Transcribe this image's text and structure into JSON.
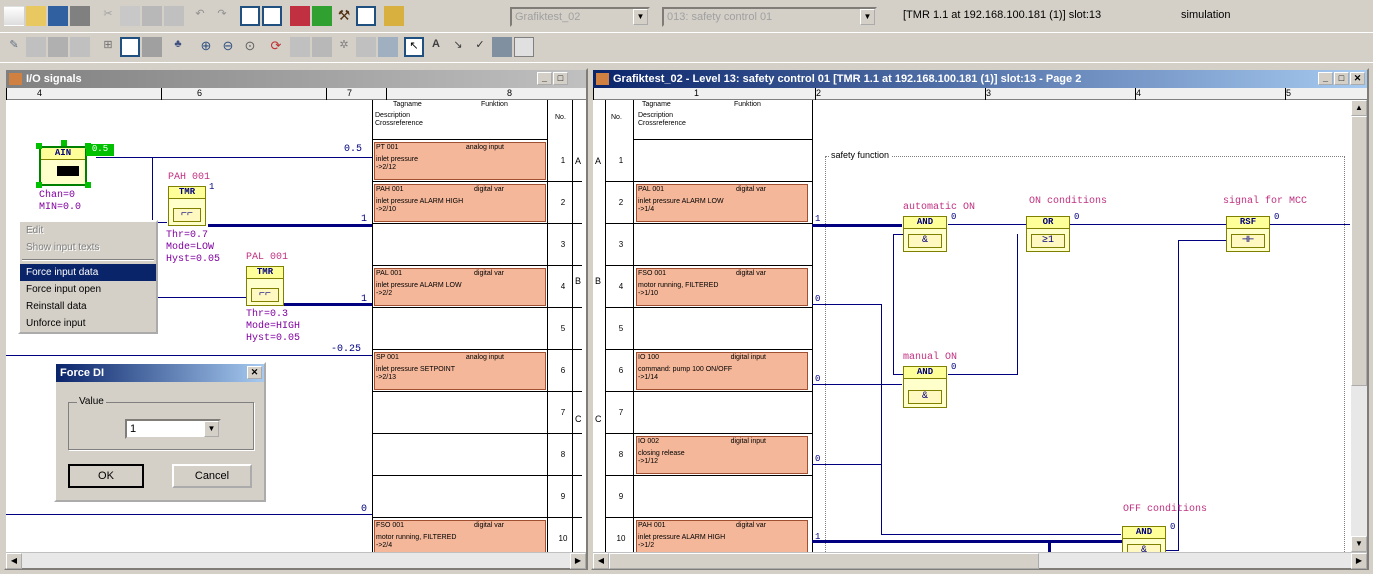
{
  "toolbar": {
    "combo1": "Grafiktest_02",
    "combo2": "013: safety control 01",
    "combo3": "[TMR 1.1 at 192.168.100.181 (1)] slot:13",
    "combo4": "simulation"
  },
  "left_window": {
    "title": "I/O signals",
    "ruler": [
      "4",
      "6",
      "7",
      "8"
    ],
    "table_header": {
      "tagname": "Tagname",
      "function": "Funktion",
      "description": "Description",
      "cross": "Crossreference",
      "no": "No."
    },
    "rows": [
      {
        "no": "1",
        "tag": "PT 001",
        "func": "analog input",
        "desc": "inlet pressure",
        "ref": "->2/12",
        "value": "0.5"
      },
      {
        "no": "2",
        "tag": "PAH 001",
        "func": "digital var",
        "desc": "inlet pressure ALARM HIGH",
        "ref": "->2/10",
        "value": "1"
      },
      {
        "no": "3"
      },
      {
        "no": "4",
        "tag": "PAL 001",
        "func": "digital var",
        "desc": "inlet pressure ALARM LOW",
        "ref": "->2/2",
        "value": "1"
      },
      {
        "no": "5"
      },
      {
        "no": "6",
        "tag": "SP 001",
        "func": "analog input",
        "desc": "inlet pressure SETPOINT",
        "ref": "->2/13",
        "value": "-0.25"
      },
      {
        "no": "7"
      },
      {
        "no": "8"
      },
      {
        "no": "9"
      },
      {
        "no": "10",
        "tag": "FSO 001",
        "func": "digital var",
        "desc": "motor running, FILTERED",
        "ref": "->2/4",
        "value": "0"
      }
    ],
    "row_letters": [
      "A",
      "B",
      "C"
    ],
    "fb": {
      "ain": {
        "name": "AIN",
        "sub": "Chan=0",
        "sub2": "MIN=0.0",
        "value_tag": "0.5"
      },
      "pah": {
        "label": "PAH 001",
        "type": "TMR",
        "p1": "Thr=0.7",
        "p2": "Mode=LOW",
        "p3": "Hyst=0.05"
      },
      "pal": {
        "label": "PAL 001",
        "type": "TMR",
        "p1": "Thr=0.3",
        "p2": "Mode=HIGH",
        "p3": "Hyst=0.05"
      }
    }
  },
  "context_menu": {
    "items": [
      {
        "label": "Edit",
        "state": "dis"
      },
      {
        "label": "Show input texts",
        "state": "dis"
      },
      {
        "label": "Force input data",
        "state": "sel"
      },
      {
        "label": "Force input open",
        "state": ""
      },
      {
        "label": "Reinstall data",
        "state": ""
      },
      {
        "label": "Unforce input",
        "state": ""
      }
    ]
  },
  "dialog": {
    "title": "Force DI",
    "group": "Value",
    "value": "1",
    "ok": "OK",
    "cancel": "Cancel"
  },
  "right_window": {
    "title": "Grafiktest_02 - Level 13: safety control 01 [TMR 1.1 at 192.168.100.181 (1)] slot:13 - Page 2",
    "ruler": [
      "1",
      "2",
      "3",
      "4",
      "5"
    ],
    "rows": [
      {
        "no": "1"
      },
      {
        "no": "2",
        "tag": "PAL 001",
        "func": "digital var",
        "desc": "inlet pressure ALARM LOW",
        "ref": "->1/4",
        "value": "1"
      },
      {
        "no": "3"
      },
      {
        "no": "4",
        "tag": "FSO 001",
        "func": "digital var",
        "desc": "motor running, FILTERED",
        "ref": "->1/10",
        "value": "0"
      },
      {
        "no": "5"
      },
      {
        "no": "6",
        "tag": "IO 100",
        "func": "digital input",
        "desc": "command: pump 100 ON/OFF",
        "ref": "->1/14",
        "value": "0"
      },
      {
        "no": "7"
      },
      {
        "no": "8",
        "tag": "IO 002",
        "func": "digital input",
        "desc": "closing release",
        "ref": "->1/12",
        "value": "0"
      },
      {
        "no": "9"
      },
      {
        "no": "10",
        "tag": "PAH 001",
        "func": "digital var",
        "desc": "inlet pressure ALARM HIGH",
        "ref": "->1/2",
        "value": "1"
      }
    ],
    "group_label": "safety function",
    "blocks": {
      "auto": {
        "label": "automatic ON",
        "type": "AND",
        "sym": "&",
        "out": "0"
      },
      "on": {
        "label": "ON conditions",
        "type": "OR",
        "sym": "≥1",
        "out": "0"
      },
      "sig": {
        "label": "signal for MCC",
        "type": "RSF",
        "sym": "⊣⊢",
        "out": "0"
      },
      "manual": {
        "label": "manual ON",
        "type": "AND",
        "sym": "&",
        "out": "0"
      },
      "off": {
        "label": "OFF conditions",
        "type": "AND",
        "sym": "&",
        "out": "0"
      }
    }
  }
}
